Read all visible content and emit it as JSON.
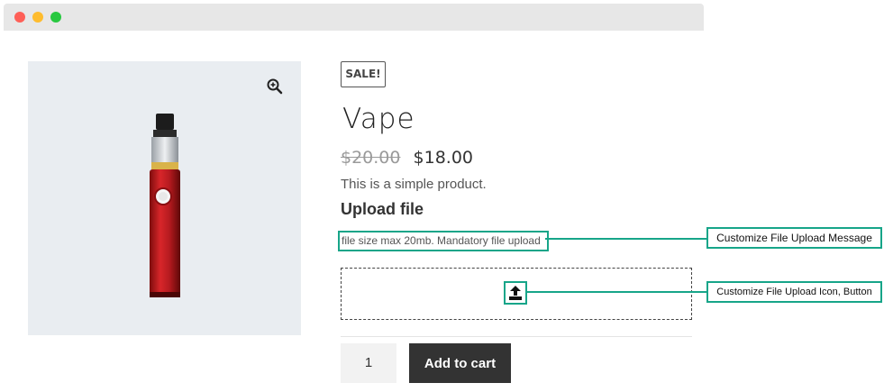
{
  "product": {
    "sale_badge": "SALE!",
    "title": "Vape",
    "old_price": "$20.00",
    "new_price": "$18.00",
    "description": "This is a simple product."
  },
  "upload": {
    "heading": "Upload file",
    "message": "file size max 20mb. Mandatory file upload"
  },
  "cart": {
    "quantity": "1",
    "add_label": "Add to cart"
  },
  "annotations": {
    "message_callout": "Customize File Upload Message",
    "icon_callout": "Customize File Upload Icon, Button"
  },
  "colors": {
    "accent": "#17a589",
    "button_bg": "#333333"
  },
  "icons": [
    "zoom-in-icon",
    "upload-icon"
  ]
}
